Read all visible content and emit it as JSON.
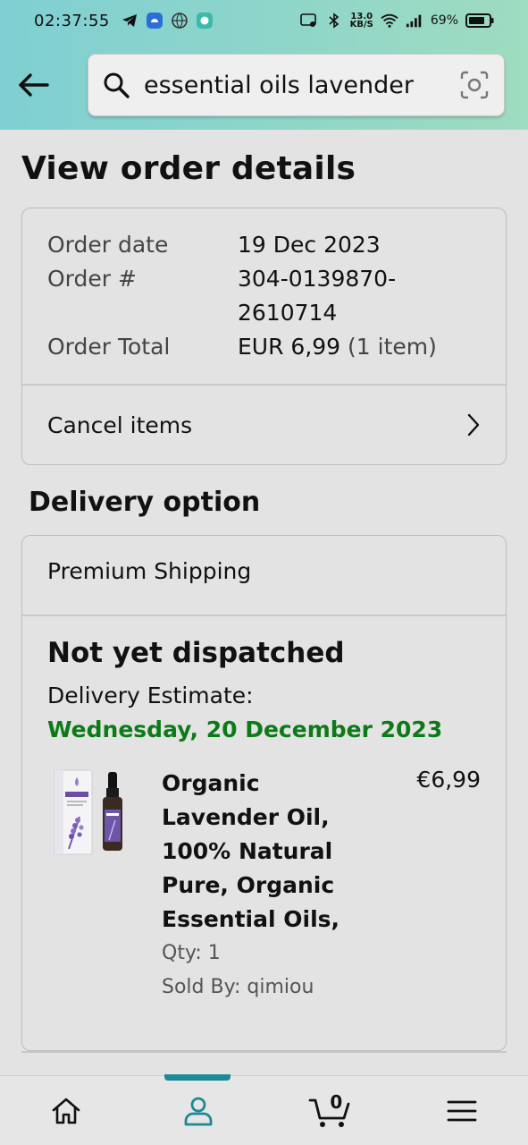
{
  "status_bar": {
    "time": "02:37:55",
    "net_speed_value": "13.0",
    "net_speed_unit": "KB/S",
    "battery": "69%"
  },
  "header": {
    "search": {
      "value": "essential oils lavender",
      "icon": "search-icon"
    }
  },
  "page": {
    "title": "View order details"
  },
  "order": {
    "date_label": "Order date",
    "date_value": "19 Dec 2023",
    "number_label": "Order #",
    "number_line1": "304-0139870-",
    "number_line2": "2610714",
    "total_label": "Order Total",
    "total_value": "EUR 6,99",
    "total_items": "(1 item)",
    "cancel_label": "Cancel items"
  },
  "delivery": {
    "section_title": "Delivery option",
    "method": "Premium Shipping",
    "status": "Not yet dispatched",
    "estimate_label": "Delivery Estimate:",
    "estimate_date": "Wednesday, 20 December 2023",
    "estimate_color": "#0d7a18"
  },
  "product": {
    "title_lines": [
      "Organic",
      "Lavender Oil,",
      "100% Natural",
      "Pure, Organic",
      "Essential Oils,"
    ],
    "price": "€6,99",
    "qty": "Qty: 1",
    "seller": "Sold By: qimiou"
  },
  "bottom_nav": {
    "cart_count": "0",
    "active_tab": "account",
    "accent_color": "#1b8a96"
  }
}
